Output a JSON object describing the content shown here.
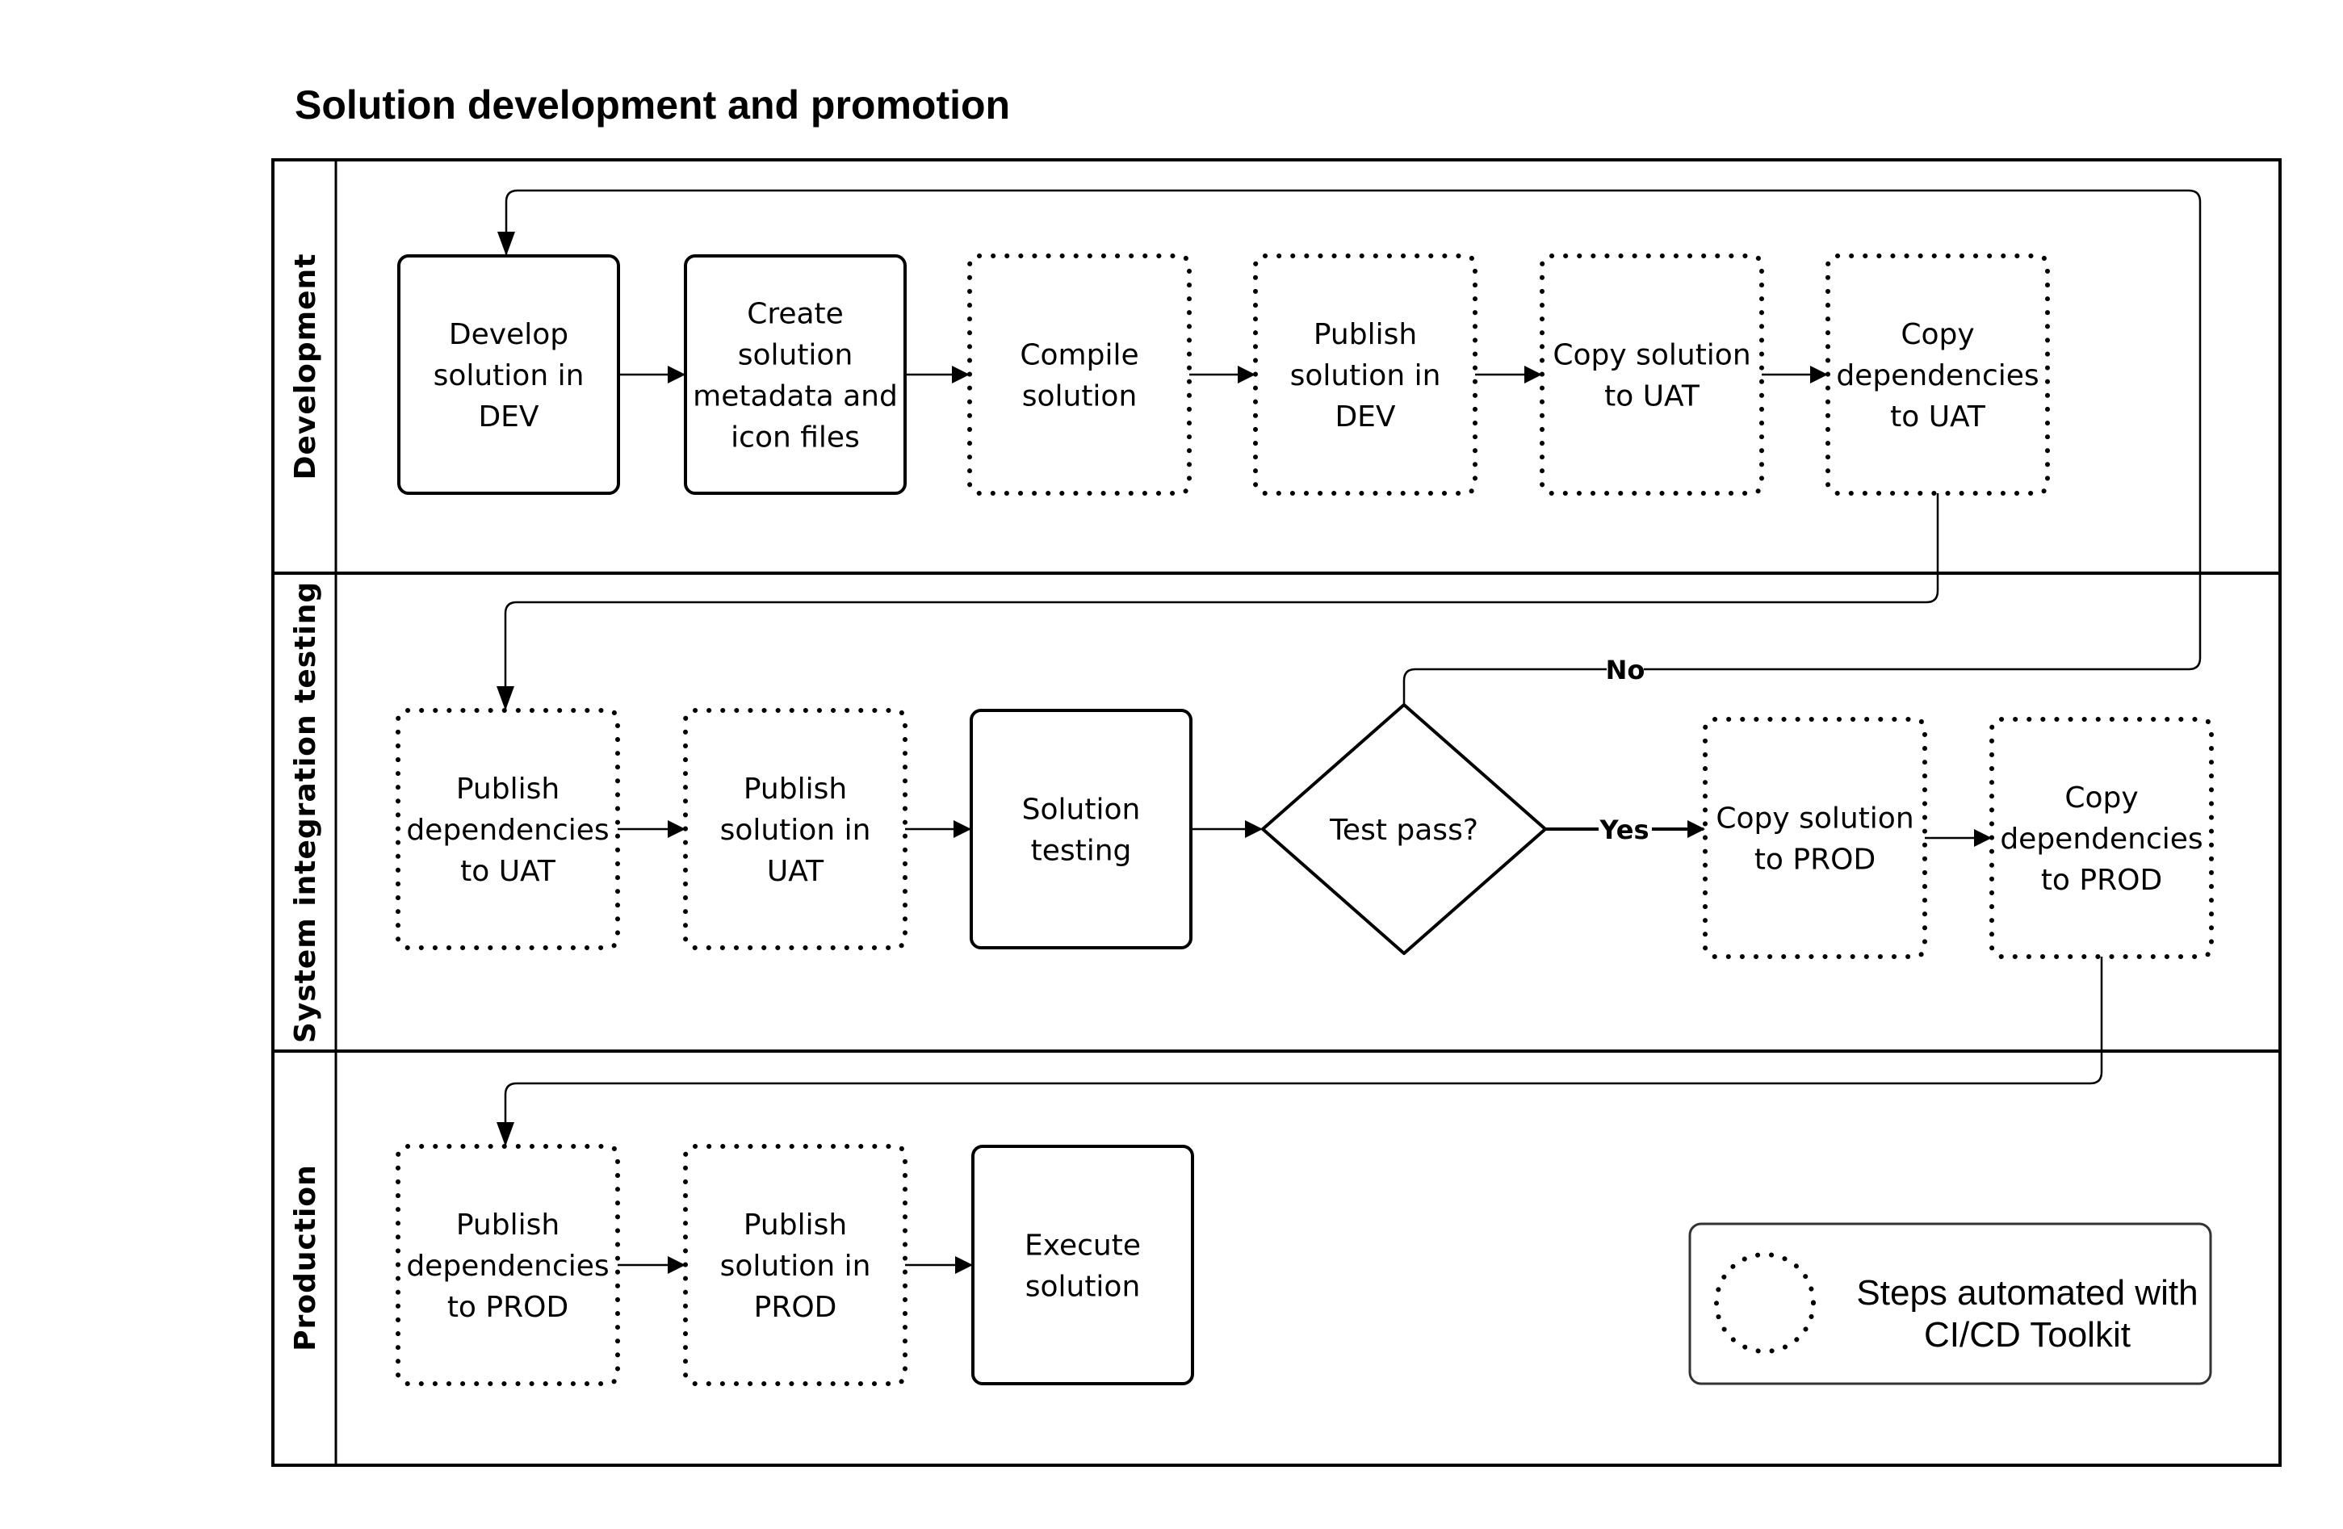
{
  "title": "Solution development and promotion",
  "lanes": [
    {
      "id": "development",
      "label": "Development"
    },
    {
      "id": "sit",
      "label": "System integration testing"
    },
    {
      "id": "production",
      "label": "Production"
    }
  ],
  "nodes": [
    {
      "id": "n1",
      "lane": "development",
      "shape": "process",
      "automated": false,
      "lines": [
        "Develop",
        "solution in",
        "DEV"
      ]
    },
    {
      "id": "n2",
      "lane": "development",
      "shape": "process",
      "automated": false,
      "lines": [
        "Create",
        "solution",
        "metadata and",
        "icon files"
      ]
    },
    {
      "id": "n3",
      "lane": "development",
      "shape": "process",
      "automated": true,
      "lines": [
        "Compile",
        "solution"
      ]
    },
    {
      "id": "n4",
      "lane": "development",
      "shape": "process",
      "automated": true,
      "lines": [
        "Publish",
        "solution in",
        "DEV"
      ]
    },
    {
      "id": "n5",
      "lane": "development",
      "shape": "process",
      "automated": true,
      "lines": [
        "Copy solution",
        "to UAT"
      ]
    },
    {
      "id": "n6",
      "lane": "development",
      "shape": "process",
      "automated": true,
      "lines": [
        "Copy",
        "dependencies",
        "to UAT"
      ]
    },
    {
      "id": "n7",
      "lane": "sit",
      "shape": "process",
      "automated": true,
      "lines": [
        "Publish",
        "dependencies",
        "to UAT"
      ]
    },
    {
      "id": "n8",
      "lane": "sit",
      "shape": "process",
      "automated": true,
      "lines": [
        "Publish",
        "solution in",
        "UAT"
      ]
    },
    {
      "id": "n9",
      "lane": "sit",
      "shape": "process",
      "automated": false,
      "lines": [
        "Solution",
        "testing"
      ]
    },
    {
      "id": "d1",
      "lane": "sit",
      "shape": "decision",
      "automated": false,
      "lines": [
        "Test pass?"
      ]
    },
    {
      "id": "n10",
      "lane": "sit",
      "shape": "process",
      "automated": true,
      "lines": [
        "Copy solution",
        "to PROD"
      ]
    },
    {
      "id": "n11",
      "lane": "sit",
      "shape": "process",
      "automated": true,
      "lines": [
        "Copy",
        "dependencies",
        "to PROD"
      ]
    },
    {
      "id": "n12",
      "lane": "production",
      "shape": "process",
      "automated": true,
      "lines": [
        "Publish",
        "dependencies",
        "to PROD"
      ]
    },
    {
      "id": "n13",
      "lane": "production",
      "shape": "process",
      "automated": true,
      "lines": [
        "Publish",
        "solution in",
        "PROD"
      ]
    },
    {
      "id": "n14",
      "lane": "production",
      "shape": "process",
      "automated": false,
      "lines": [
        "Execute",
        "solution"
      ]
    }
  ],
  "edges": [
    {
      "from": "n1",
      "to": "n2",
      "label": ""
    },
    {
      "from": "n2",
      "to": "n3",
      "label": ""
    },
    {
      "from": "n3",
      "to": "n4",
      "label": ""
    },
    {
      "from": "n4",
      "to": "n5",
      "label": ""
    },
    {
      "from": "n5",
      "to": "n6",
      "label": ""
    },
    {
      "from": "n6",
      "to": "n7",
      "label": ""
    },
    {
      "from": "n7",
      "to": "n8",
      "label": ""
    },
    {
      "from": "n8",
      "to": "n9",
      "label": ""
    },
    {
      "from": "n9",
      "to": "d1",
      "label": ""
    },
    {
      "from": "d1",
      "to": "n10",
      "label": "Yes"
    },
    {
      "from": "d1",
      "to": "n1",
      "label": "No"
    },
    {
      "from": "n10",
      "to": "n11",
      "label": ""
    },
    {
      "from": "n11",
      "to": "n12",
      "label": ""
    },
    {
      "from": "n12",
      "to": "n13",
      "label": ""
    },
    {
      "from": "n13",
      "to": "n14",
      "label": ""
    }
  ],
  "legend": {
    "symbol": "dotted-circle",
    "lines": [
      "Steps automated with",
      "CI/CD Toolkit"
    ]
  }
}
